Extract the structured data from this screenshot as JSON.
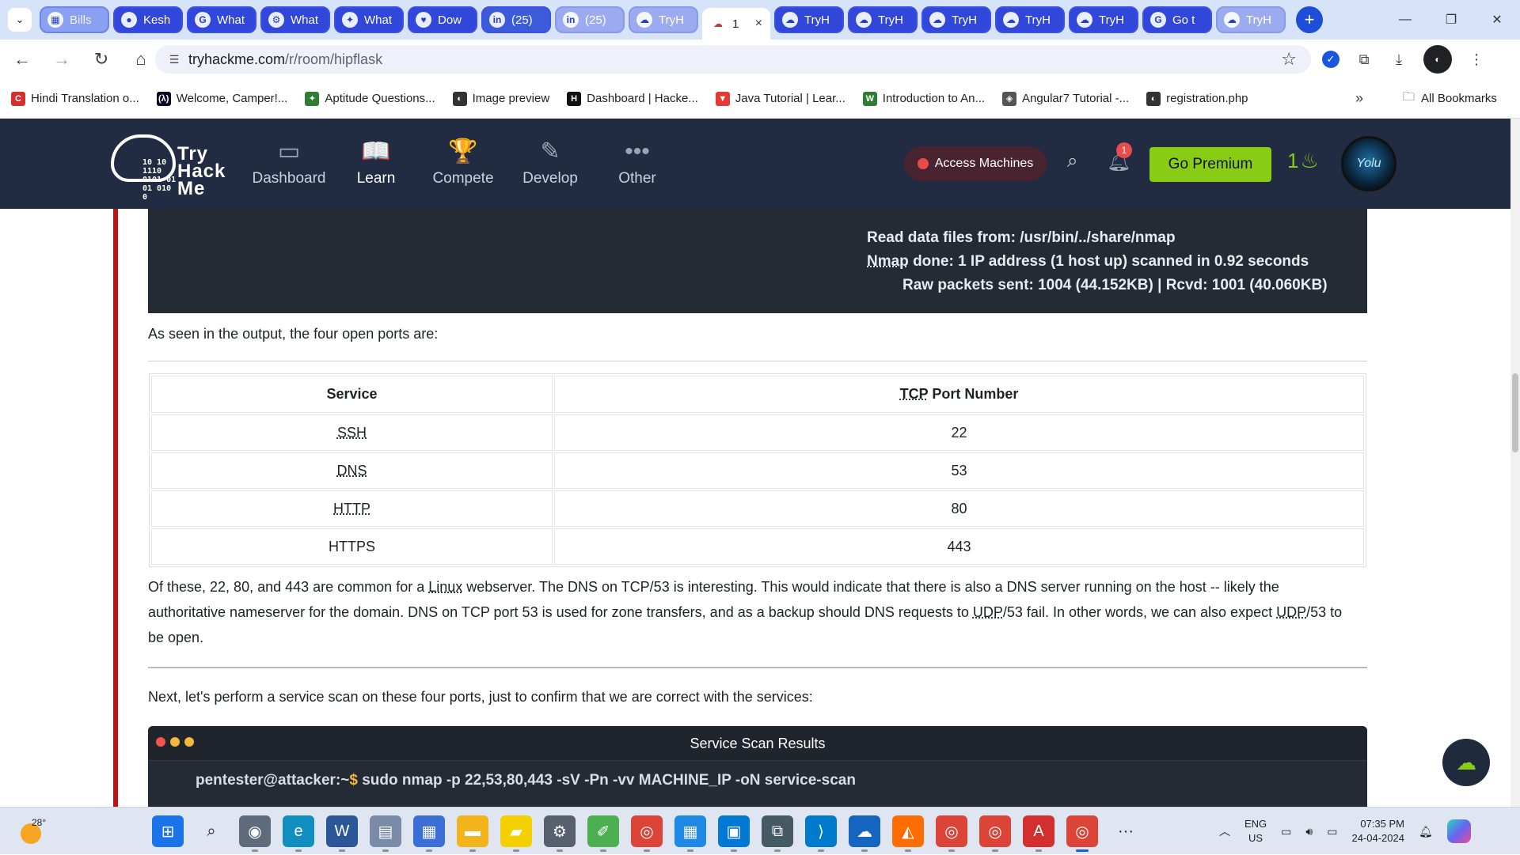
{
  "browser": {
    "tabs": [
      {
        "title": "Bills",
        "icon": "sheets-icon",
        "style": "g1"
      },
      {
        "title": "Kesh",
        "icon": "github-icon",
        "style": "g2"
      },
      {
        "title": "What",
        "icon": "google-icon",
        "style": "g2"
      },
      {
        "title": "What",
        "icon": "network-icon",
        "style": "g2"
      },
      {
        "title": "What",
        "icon": "satellite-icon",
        "style": "g2"
      },
      {
        "title": "Dow",
        "icon": "heart-icon",
        "style": "g2"
      },
      {
        "title": "(25)",
        "icon": "linkedin-icon",
        "style": "g4"
      },
      {
        "title": "(25)",
        "icon": "linkedin-icon",
        "style": "g3"
      },
      {
        "title": "TryH",
        "icon": "tryhackme-icon",
        "style": "g3"
      }
    ],
    "active_tab": {
      "title": "1",
      "icon": "tryhackme-icon",
      "close": "×"
    },
    "tabs_after": [
      {
        "title": "TryH",
        "icon": "tryhackme-icon",
        "style": "g2"
      },
      {
        "title": "TryH",
        "icon": "tryhackme-icon",
        "style": "g2"
      },
      {
        "title": "TryH",
        "icon": "tryhackme-icon",
        "style": "g2"
      },
      {
        "title": "TryH",
        "icon": "tryhackme-icon",
        "style": "g2"
      },
      {
        "title": "TryH",
        "icon": "tryhackme-icon",
        "style": "g2"
      },
      {
        "title": "Go t",
        "icon": "google-icon",
        "style": "g2"
      },
      {
        "title": "TryH",
        "icon": "tryhackme-icon",
        "style": "g3"
      }
    ],
    "new_tab": "+",
    "url_host": "tryhackme.com",
    "url_path": "/r/room/hipflask",
    "bookmarks": [
      {
        "label": "Hindi Translation o...",
        "color": "#d32f2f",
        "glyph": "C"
      },
      {
        "label": "Welcome, Camper!...",
        "color": "#0a0a23",
        "glyph": "(λ)"
      },
      {
        "label": "Aptitude Questions...",
        "color": "#2e7d32",
        "glyph": "✦"
      },
      {
        "label": "Image preview",
        "color": "#333333",
        "glyph": "◐"
      },
      {
        "label": "Dashboard | Hacke...",
        "color": "#111111",
        "glyph": "H"
      },
      {
        "label": "Java Tutorial | Lear...",
        "color": "#e53935",
        "glyph": "▼"
      },
      {
        "label": "Introduction to An...",
        "color": "#2e7d32",
        "glyph": "W"
      },
      {
        "label": "Angular7 Tutorial -...",
        "color": "#555555",
        "glyph": "◈"
      },
      {
        "label": "registration.php",
        "color": "#333333",
        "glyph": "◐"
      }
    ],
    "bookmarks_more": "»",
    "all_bookmarks": "All Bookmarks"
  },
  "thm": {
    "logo_words": [
      "Try",
      "Hack",
      "Me"
    ],
    "logo_bits": [
      "10  10",
      "1110",
      "0101 01",
      "01  010",
      "0"
    ],
    "nav": [
      {
        "label": "Dashboard",
        "icon": "dashboard-icon",
        "glyph": "▭",
        "active": false
      },
      {
        "label": "Learn",
        "icon": "book-icon",
        "glyph": "📖",
        "active": true
      },
      {
        "label": "Compete",
        "icon": "trophy-icon",
        "glyph": "🏆",
        "active": false
      },
      {
        "label": "Develop",
        "icon": "pencil-icon",
        "glyph": "✎",
        "active": false
      },
      {
        "label": "Other",
        "icon": "more-icon",
        "glyph": "•••",
        "active": false
      }
    ],
    "access_machines": "Access Machines",
    "notifications_count": "1",
    "go_premium": "Go Premium",
    "streak": "1",
    "avatar_text": "Yolu"
  },
  "content": {
    "terminal_lines": [
      "Read data files from: /usr/bin/../share/nmap",
      "Nmap done: 1 IP address (1 host up) scanned in 0.92 seconds",
      "Raw packets sent: 1004 (44.152KB) | Rcvd: 1001 (40.060KB)"
    ],
    "intro": "As seen in the output, the four open ports are:",
    "table": {
      "headers": [
        "Service",
        "TCP Port Number"
      ],
      "rows": [
        [
          "SSH",
          "22"
        ],
        [
          "DNS",
          "53"
        ],
        [
          "HTTP",
          "80"
        ],
        [
          "HTTPS",
          "443"
        ]
      ]
    },
    "para_lines": [
      "Of these, 22, 80, and 443 are common for a Linux webserver. The DNS on TCP/53 is interesting. This would indicate that there is also a DNS server running on the host -- likely the",
      "authoritative nameserver for the domain. DNS on TCP port 53 is used for zone transfers, and as a backup should DNS requests to UDP/53 fail. In other words, we can also expect UDP/53 to",
      "be open."
    ],
    "next": "Next, let's perform a service scan on these four ports, just to confirm that we are correct with the services:",
    "service_scan_title": "Service Scan Results",
    "prompt": "pentester@attacker:~$",
    "command": " sudo nmap -p 22,53,80,443 -sV -Pn -vv MACHINE_IP -oN service-scan"
  },
  "taskbar": {
    "temperature": "28°",
    "lang_top": "ENG",
    "lang_bottom": "US",
    "time": "07:35 PM",
    "date": "24-04-2024",
    "apps": [
      {
        "name": "start-icon",
        "glyph": "⊞",
        "bg": "#1a73e8"
      },
      {
        "name": "search-icon",
        "glyph": "⌕",
        "bg": "transparent"
      },
      {
        "name": "camera-icon",
        "glyph": "◉",
        "bg": "#5f6b7a"
      },
      {
        "name": "edge-icon",
        "glyph": "e",
        "bg": "#0f8fbf"
      },
      {
        "name": "word-icon",
        "glyph": "W",
        "bg": "#2b579a"
      },
      {
        "name": "notepad-icon",
        "glyph": "▤",
        "bg": "#7a8ba8"
      },
      {
        "name": "store-icon",
        "glyph": "▦",
        "bg": "#3b6fd6"
      },
      {
        "name": "folder-icon",
        "glyph": "▬",
        "bg": "#f2b31b"
      },
      {
        "name": "sticky-notes-icon",
        "glyph": "▰",
        "bg": "#f5d000"
      },
      {
        "name": "settings-icon",
        "glyph": "⚙",
        "bg": "#56606e"
      },
      {
        "name": "paint-icon",
        "glyph": "✐",
        "bg": "#4caf50"
      },
      {
        "name": "chrome-icon",
        "glyph": "◎",
        "bg": "#db4437"
      },
      {
        "name": "calendar-icon",
        "glyph": "▦",
        "bg": "#1e88e5"
      },
      {
        "name": "remote-desktop-icon",
        "glyph": "▣",
        "bg": "#0078d4"
      },
      {
        "name": "network-tool-icon",
        "glyph": "⧉",
        "bg": "#455a64"
      },
      {
        "name": "vscode-icon",
        "glyph": "⟩",
        "bg": "#007acc"
      },
      {
        "name": "cloud-icon",
        "glyph": "☁",
        "bg": "#1565c0"
      },
      {
        "name": "app-icon",
        "glyph": "◭",
        "bg": "#ff6d00"
      },
      {
        "name": "chrome-profile-icon",
        "glyph": "◎",
        "bg": "#db4437"
      },
      {
        "name": "chrome-profile2-icon",
        "glyph": "◎",
        "bg": "#db4437"
      },
      {
        "name": "pdf-icon",
        "glyph": "A",
        "bg": "#d32f2f"
      },
      {
        "name": "chrome-active-icon",
        "glyph": "◎",
        "bg": "#db4437",
        "active": true
      },
      {
        "name": "more-apps-icon",
        "glyph": "···",
        "bg": "transparent"
      }
    ]
  }
}
